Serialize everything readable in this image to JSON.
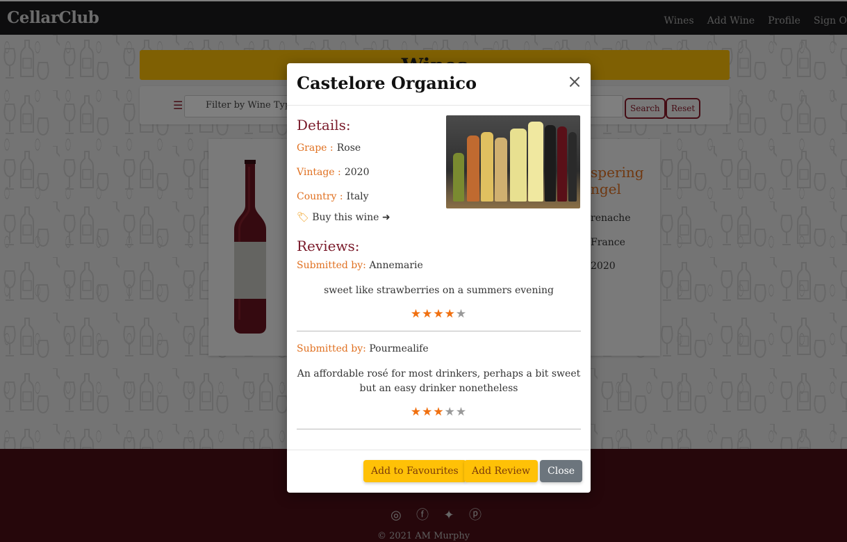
{
  "navbar": {
    "brand": "CellarClub",
    "links": [
      "Wines",
      "Add Wine",
      "Profile",
      "Sign O"
    ]
  },
  "page": {
    "banner_title": "Wines",
    "filter_placeholder": "Filter by Wine Typ",
    "search_label": "Search",
    "reset_label": "Reset",
    "right_card": {
      "title_line1": "spering",
      "title_line2": "ngel",
      "line1": "renache",
      "line2": "France",
      "line3": "2020"
    }
  },
  "modal": {
    "title": "Castelore Organico",
    "details_heading": "Details:",
    "grape_label": "Grape :",
    "grape_value": "Rose",
    "vintage_label": "Vintage :",
    "vintage_value": "2020",
    "country_label": "Country :",
    "country_value": "Italy",
    "buy_label": "Buy this wine",
    "reviews_heading": "Reviews:",
    "reviews": [
      {
        "submitted_label": "Submitted by:",
        "author": "Annemarie",
        "text": "sweet like strawberries on a summers evening",
        "rating": 4,
        "max": 5
      },
      {
        "submitted_label": "Submitted by:",
        "author": "Pourmealife",
        "text": "An affordable rosé for most drinkers, perhaps a bit sweet but an easy drinker nonetheless",
        "rating": 3,
        "max": 5
      }
    ],
    "buttons": {
      "favourites": "Add to Favourites",
      "add_review": "Add Review",
      "close": "Close"
    }
  },
  "footer": {
    "copyright": "© 2021 AM Murphy",
    "social_icons": [
      "instagram-icon",
      "facebook-icon",
      "twitter-icon",
      "pinterest-icon"
    ]
  },
  "colors": {
    "accent_yellow": "#ffc107",
    "wine_red": "#7a1a2a",
    "label_orange": "#e07020",
    "footer_bg": "#4c0f17",
    "navbar_bg": "#1a1b1d"
  }
}
